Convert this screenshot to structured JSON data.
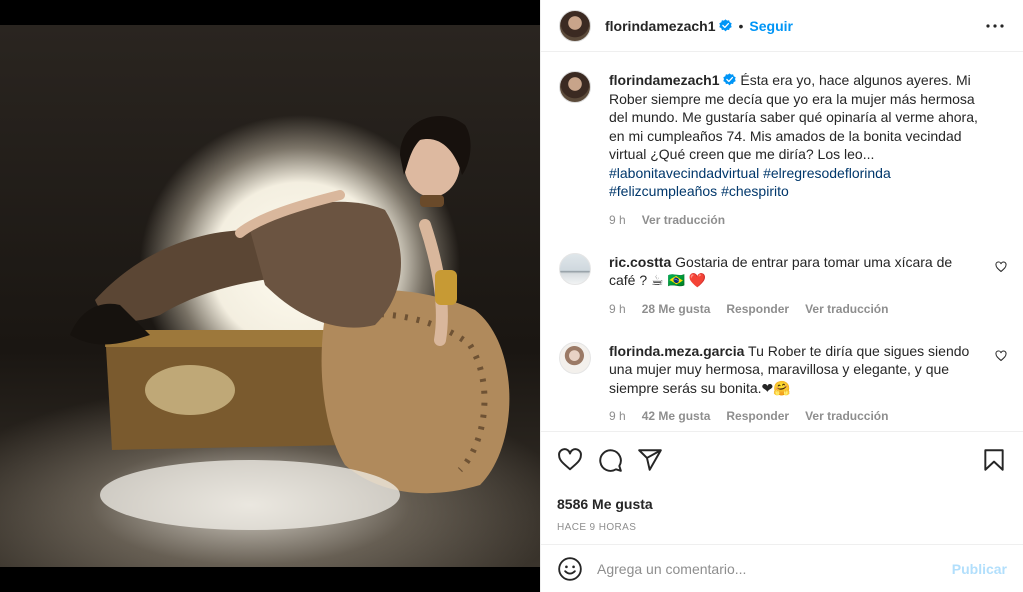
{
  "post": {
    "username": "florindamezach1",
    "follow_label": "Seguir",
    "dot": "•"
  },
  "caption": {
    "username": "florindamezach1",
    "text": "Ésta era yo, hace algunos ayeres. Mi Rober siempre me decía que yo era la mujer más hermosa del mundo. Me gustaría saber qué opinaría al verme ahora, en mi cumpleaños 74. Mis amados de la bonita vecindad virtual ¿Qué creen que me diría? Los leo...",
    "hashtags": [
      "#labonitavecindadvirtual",
      "#elregresodeflorinda",
      "#felizcumpleaños",
      "#chespirito"
    ],
    "time": "9 h",
    "translate": "Ver traducción"
  },
  "comments": [
    {
      "username": "ric.costta",
      "text": "Gostaria de entrar para tomar uma xícara de café ? ☕ 🇧🇷 ❤️",
      "time": "9 h",
      "likes": "28 Me gusta",
      "reply": "Responder",
      "translate": "Ver traducción"
    },
    {
      "username": "florinda.meza.garcia",
      "text": "Tu Rober te diría que sigues siendo una mujer muy hermosa, maravillosa y elegante, y que siempre serás su bonita.❤🤗",
      "time": "9 h",
      "likes": "42 Me gusta",
      "reply": "Responder",
      "translate": "Ver traducción"
    }
  ],
  "footer": {
    "likes": "8586 Me gusta",
    "ago": "HACE 9 HORAS",
    "comment_placeholder": "Agrega un comentario...",
    "post_label": "Publicar"
  },
  "icons": {
    "like": "heart-icon",
    "comment": "comment-icon",
    "share": "paper-plane-icon",
    "save": "bookmark-icon",
    "more": "more-options-icon",
    "emoji": "emoji-icon",
    "verified": "verified-badge-icon"
  },
  "colors": {
    "link": "#0095f6",
    "hashtag": "#00376b",
    "muted": "#8e8e8e",
    "publish_disabled": "#b2dffc"
  }
}
